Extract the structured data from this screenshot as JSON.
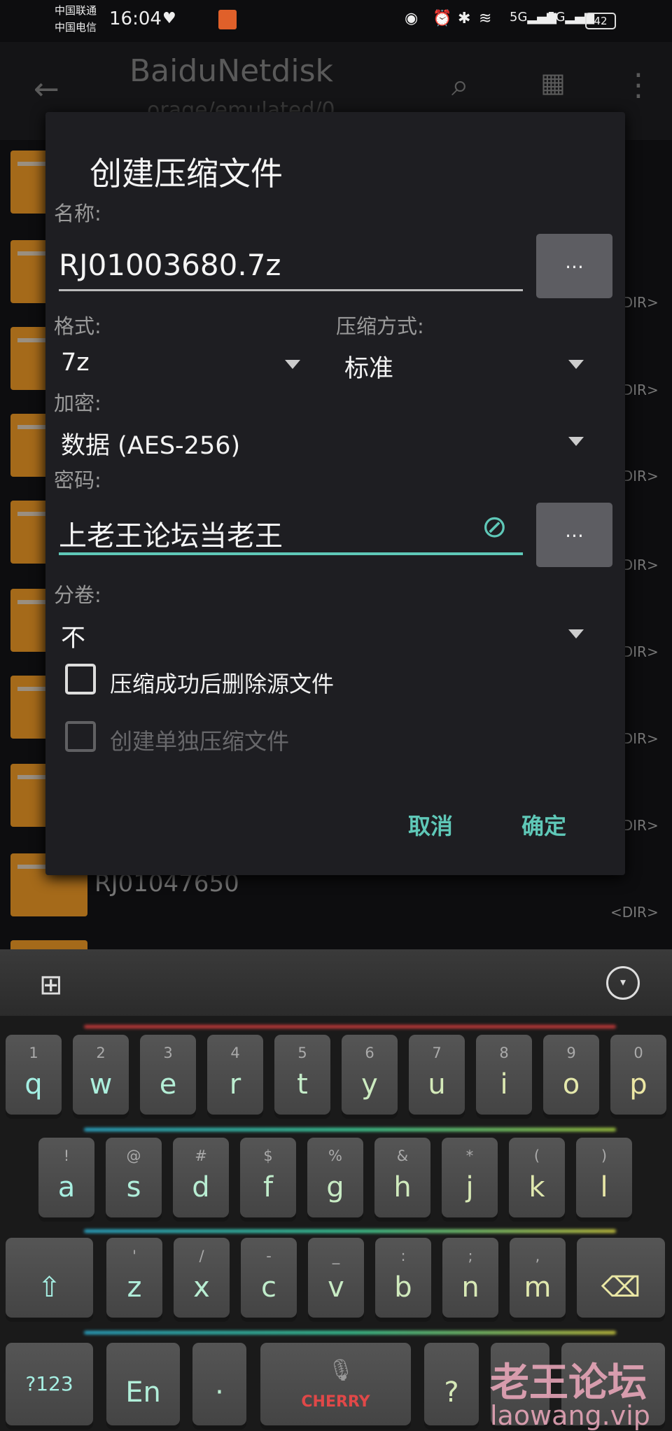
{
  "status_bar": {
    "carrier1": "中国联通",
    "carrier2": "中国电信",
    "time": "16:04",
    "battery": "42",
    "signal1": "5G",
    "signal2": "5G"
  },
  "app_bar": {
    "title": "BaiduNetdisk",
    "subtitle": "orage/emulated/0"
  },
  "background_list": {
    "visible_file": "RJ01047650",
    "dir_label": "<DIR>"
  },
  "dialog": {
    "title": "创建压缩文件",
    "name_label": "名称:",
    "name_value": "RJ01003680.7z",
    "browse": "...",
    "format_label": "格式:",
    "format_value": "7z",
    "method_label": "压缩方式:",
    "method_value": "标准",
    "encrypt_label": "加密:",
    "encrypt_value": "数据 (AES-256)",
    "password_label": "密码:",
    "password_value": "上老王论坛当老王",
    "split_label": "分卷:",
    "split_value": "不",
    "delete_source": {
      "label": "压缩成功后删除源文件",
      "checked": false
    },
    "separate_archives": {
      "label": "创建单独压缩文件",
      "checked": false,
      "disabled": true
    },
    "cancel": "取消",
    "ok": "确定",
    "accent": "#5fc8b8"
  },
  "keyboard": {
    "row1": [
      [
        "1",
        "q"
      ],
      [
        "2",
        "w"
      ],
      [
        "3",
        "e"
      ],
      [
        "4",
        "r"
      ],
      [
        "5",
        "t"
      ],
      [
        "6",
        "y"
      ],
      [
        "7",
        "u"
      ],
      [
        "8",
        "i"
      ],
      [
        "9",
        "o"
      ],
      [
        "0",
        "p"
      ]
    ],
    "row2": [
      [
        "!",
        "a"
      ],
      [
        "@",
        "s"
      ],
      [
        "#",
        "d"
      ],
      [
        "$",
        "f"
      ],
      [
        "%",
        "g"
      ],
      [
        "&",
        "h"
      ],
      [
        "*",
        "j"
      ],
      [
        "(",
        "k"
      ],
      [
        ")",
        "l"
      ]
    ],
    "row3": [
      [
        "'",
        "z"
      ],
      [
        "/",
        "x"
      ],
      [
        "-",
        "c"
      ],
      [
        "_",
        "v"
      ],
      [
        ":",
        "b"
      ],
      [
        ";",
        "n"
      ],
      [
        ",",
        "m"
      ]
    ],
    "shift": "⇧",
    "backspace": "⌫",
    "symbols": "?123",
    "lang": "En",
    "dot": "·",
    "space_brand": "CHERRY",
    "question": "?",
    "watermark": "老王论坛",
    "watermark_url": "laowang.vip"
  }
}
